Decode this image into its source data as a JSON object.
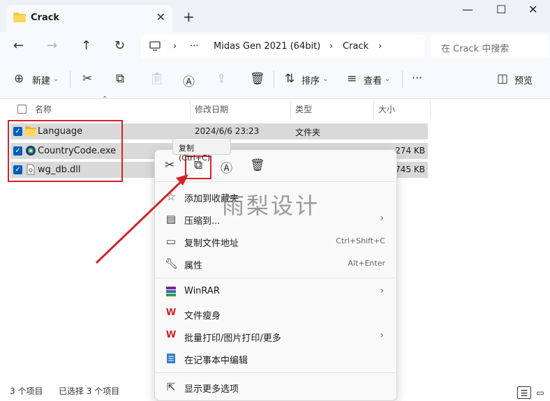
{
  "tab": {
    "title": "Crack",
    "close": "✕",
    "new_tab": "+"
  },
  "window": {
    "minimize": "—",
    "maximize": "☐",
    "close": "✕"
  },
  "address": {
    "crumbs": [
      "Midas Gen 2021 (64bit)",
      "Crack"
    ],
    "more": "···",
    "search_placeholder": "在 Crack 中搜索"
  },
  "toolbar": {
    "new_label": "新建",
    "sort_label": "排序",
    "view_label": "查看",
    "more": "···",
    "preview_label": "预览"
  },
  "columns": [
    "名称",
    "修改日期",
    "类型",
    "大小"
  ],
  "files": [
    {
      "name": "Language",
      "date": "2024/6/6 23:23",
      "type": "文件夹",
      "size": "",
      "icon": "folder-icon"
    },
    {
      "name": "CountryCode.exe",
      "date": "",
      "type": "",
      "size": "274 KB",
      "icon": "exe-icon"
    },
    {
      "name": "wg_db.dll",
      "date": "",
      "type": "",
      "size": "745 KB",
      "icon": "dll-icon"
    }
  ],
  "tooltip": "复制 (Ctrl+C)",
  "context_menu": {
    "items": [
      {
        "label": "添加到收藏夹",
        "icon": "star-icon",
        "shortcut": "",
        "submenu": false
      },
      {
        "label": "压缩到...",
        "icon": "zip-icon",
        "shortcut": "",
        "submenu": true
      },
      {
        "label": "复制文件地址",
        "icon": "path-icon",
        "shortcut": "Ctrl+Shift+C",
        "submenu": false
      },
      {
        "label": "属性",
        "icon": "wrench-icon",
        "shortcut": "Alt+Enter",
        "submenu": false
      },
      {
        "label": "WinRAR",
        "icon": "winrar-icon",
        "shortcut": "",
        "submenu": true
      },
      {
        "label": "文件瘦身",
        "icon": "wps-icon",
        "shortcut": "",
        "submenu": false
      },
      {
        "label": "批量打印/图片打印/更多",
        "icon": "wps-icon",
        "shortcut": "",
        "submenu": true
      },
      {
        "label": "在记事本中编辑",
        "icon": "notepad-icon",
        "shortcut": "",
        "submenu": false
      },
      {
        "label": "显示更多选项",
        "icon": "more-options-icon",
        "shortcut": "",
        "submenu": false
      }
    ]
  },
  "watermark": "雨梨设计",
  "status": {
    "items": "3 个项目",
    "selected": "已选择 3 个项目"
  },
  "colors": {
    "accent": "#005fb8",
    "highlight": "#d2232a",
    "selection": "#d9d9d9"
  }
}
